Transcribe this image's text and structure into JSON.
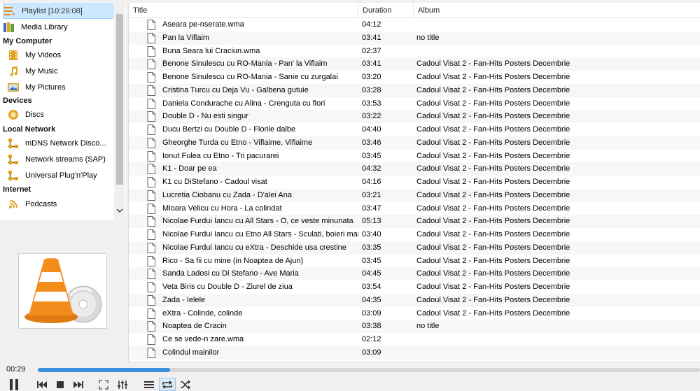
{
  "sidebar": {
    "playlist": "Playlist [10:26:08]",
    "media_library": "Media Library",
    "sections": {
      "my_computer": "My Computer",
      "devices": "Devices",
      "local_network": "Local Network",
      "internet": "Internet"
    },
    "my_videos": "My Videos",
    "my_music": "My Music",
    "my_pictures": "My Pictures",
    "discs": "Discs",
    "mdns": "mDNS Network Disco...",
    "sap": "Network streams (SAP)",
    "upnp": "Universal Plug'n'Play",
    "podcasts": "Podcasts"
  },
  "playlist": {
    "headers": {
      "title": "Title",
      "duration": "Duration",
      "album": "Album"
    },
    "rows": [
      {
        "title": "Aseara pe-nserate.wma",
        "duration": "04:12",
        "album": ""
      },
      {
        "title": "Pan la Viflaim",
        "duration": "03:41",
        "album": "no title"
      },
      {
        "title": "Buna Seara lui Craciun.wma",
        "duration": "02:37",
        "album": ""
      },
      {
        "title": "Benone Sinulescu cu RO-Mania - Pan' la Viflaim",
        "duration": "03:41",
        "album": "Cadoul Visat 2 - Fan-Hits Posters Decembrie"
      },
      {
        "title": "Benone Sinulescu cu RO-Mania - Sanie cu zurgalai",
        "duration": "03:20",
        "album": "Cadoul Visat 2 - Fan-Hits Posters Decembrie"
      },
      {
        "title": "Cristina Turcu cu Deja Vu - Galbena gutuie",
        "duration": "03:28",
        "album": "Cadoul Visat 2 - Fan-Hits Posters Decembrie"
      },
      {
        "title": "Daniela Condurache cu Alina - Crenguta cu flori",
        "duration": "03:53",
        "album": "Cadoul Visat 2 - Fan-Hits Posters Decembrie"
      },
      {
        "title": "Double D - Nu esti singur",
        "duration": "03:22",
        "album": "Cadoul Visat 2 - Fan-Hits Posters Decembrie"
      },
      {
        "title": "Ducu Bertzi cu Double D - Florile dalbe",
        "duration": "04:40",
        "album": "Cadoul Visat 2 - Fan-Hits Posters Decembrie"
      },
      {
        "title": "Gheorghe Turda cu Etno - Viflaime, Viflaime",
        "duration": "03:46",
        "album": "Cadoul Visat 2 - Fan-Hits Posters Decembrie"
      },
      {
        "title": "Ionut Fulea cu Etno - Tri pacurarei",
        "duration": "03:45",
        "album": "Cadoul Visat 2 - Fan-Hits Posters Decembrie"
      },
      {
        "title": "K1 - Doar pe ea",
        "duration": "04:32",
        "album": "Cadoul Visat 2 - Fan-Hits Posters Decembrie"
      },
      {
        "title": "K1 cu DiStefano - Cadoul visat",
        "duration": "04:16",
        "album": "Cadoul Visat 2 - Fan-Hits Posters Decembrie"
      },
      {
        "title": "Lucretia Ciobanu cu Zada - D'alei Ana",
        "duration": "03:21",
        "album": "Cadoul Visat 2 - Fan-Hits Posters Decembrie"
      },
      {
        "title": "Mioara Velicu cu Hora - La colindat",
        "duration": "03:47",
        "album": "Cadoul Visat 2 - Fan-Hits Posters Decembrie"
      },
      {
        "title": "Nicolae Furdui Iancu cu All Stars - O, ce veste minunata",
        "duration": "05:13",
        "album": "Cadoul Visat 2 - Fan-Hits Posters Decembrie"
      },
      {
        "title": "Nicolae Furdui Iancu cu Etno All Stars - Sculati, boieri mari",
        "duration": "03:40",
        "album": "Cadoul Visat 2 - Fan-Hits Posters Decembrie"
      },
      {
        "title": "Nicolae Furdui Iancu cu eXtra - Deschide usa crestine",
        "duration": "03:35",
        "album": "Cadoul Visat 2 - Fan-Hits Posters Decembrie"
      },
      {
        "title": "Rico - Sa fii cu mine (in Noaptea de Ajun)",
        "duration": "03:45",
        "album": "Cadoul Visat 2 - Fan-Hits Posters Decembrie"
      },
      {
        "title": "Sanda Ladosi cu Di Stefano - Ave Maria",
        "duration": "04:45",
        "album": "Cadoul Visat 2 - Fan-Hits Posters Decembrie"
      },
      {
        "title": "Veta Biris cu Double D - Ziurel de ziua",
        "duration": "03:54",
        "album": "Cadoul Visat 2 - Fan-Hits Posters Decembrie"
      },
      {
        "title": "Zada - Ielele",
        "duration": "04:35",
        "album": "Cadoul Visat 2 - Fan-Hits Posters Decembrie"
      },
      {
        "title": "eXtra - Colinde, colinde",
        "duration": "03:09",
        "album": "Cadoul Visat 2 - Fan-Hits Posters Decembrie"
      },
      {
        "title": "Noaptea de Cracin",
        "duration": "03:38",
        "album": "no title"
      },
      {
        "title": "Ce se vede-n zare.wma",
        "duration": "02:12",
        "album": ""
      },
      {
        "title": "Colindul mainilor",
        "duration": "03:09",
        "album": ""
      }
    ]
  },
  "player": {
    "elapsed": "00:29",
    "progress_fraction": 0.2,
    "accent_color": "#3b8ee0"
  },
  "icons": {
    "pause": "pause-icon",
    "previous": "skip-previous-icon",
    "stop": "stop-icon",
    "next": "skip-next-icon",
    "fullscreen": "fullscreen-icon",
    "extended": "equalizer-icon",
    "playlist": "playlist-icon",
    "loop": "loop-icon",
    "random": "shuffle-icon"
  }
}
